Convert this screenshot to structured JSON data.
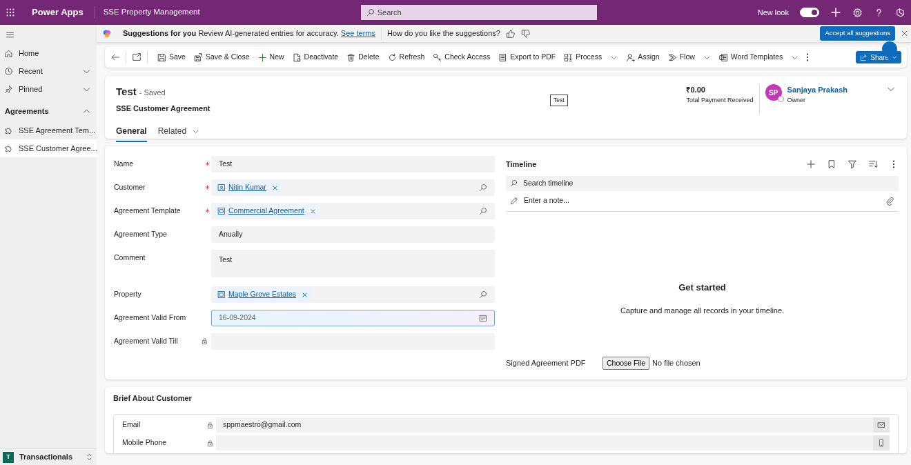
{
  "app_bar": {
    "app_name": "Power Apps",
    "environment": "SSE Property Management",
    "search_placeholder": "Search",
    "new_look": {
      "label": "New look",
      "on": true
    }
  },
  "sidebar": {
    "items": [
      {
        "label": "Home"
      },
      {
        "label": "Recent",
        "expanded": false
      },
      {
        "label": "Pinned",
        "expanded": false
      }
    ],
    "group": {
      "label": "Agreements",
      "expanded": true,
      "items": [
        {
          "label": "SSE Agreement Tem...",
          "selected": false
        },
        {
          "label": "SSE Customer Agree...",
          "selected": true
        }
      ]
    },
    "area": {
      "badge": "T",
      "label": "Transactionals"
    }
  },
  "suggestion_bar": {
    "title": "Suggestions for you",
    "message": "Review AI-generated entries for accuracy.",
    "link": "See terms",
    "feedback": "How do you like the suggestions?",
    "accept_button": "Accept all suggestions"
  },
  "command_bar": {
    "commands": [
      {
        "label": "Save",
        "dropdown": false
      },
      {
        "label": "Save & Close",
        "dropdown": false
      },
      {
        "label": "New",
        "dropdown": false
      },
      {
        "label": "Deactivate",
        "dropdown": false
      },
      {
        "label": "Delete",
        "dropdown": false
      },
      {
        "label": "Refresh",
        "dropdown": false
      },
      {
        "label": "Check Access",
        "dropdown": false
      },
      {
        "label": "Export to PDF",
        "dropdown": false
      },
      {
        "label": "Process",
        "dropdown": true
      },
      {
        "label": "Assign",
        "dropdown": false
      },
      {
        "label": "Flow",
        "dropdown": true
      },
      {
        "label": "Word Templates",
        "dropdown": true
      }
    ],
    "share": "Share"
  },
  "header": {
    "title": "Test",
    "status": "- Saved",
    "entity": "SSE Customer Agreement",
    "tooltip": "Test",
    "total": {
      "value": "₹0.00",
      "label": "Total Payment Received"
    },
    "owner": {
      "initials": "SP",
      "name": "Sanjaya Prakash",
      "role": "Owner"
    },
    "tabs": [
      {
        "label": "General",
        "selected": true,
        "dropdown": false
      },
      {
        "label": "Related",
        "selected": false,
        "dropdown": true
      }
    ]
  },
  "form": {
    "fields": [
      {
        "label": "Name",
        "required": true,
        "locked": false,
        "focused": false,
        "kind": "text",
        "value": "Test"
      },
      {
        "label": "Customer",
        "required": true,
        "locked": false,
        "focused": false,
        "kind": "lookup",
        "value": "Nitin Kumar"
      },
      {
        "label": "Agreement Template",
        "required": true,
        "locked": false,
        "focused": false,
        "kind": "lookup",
        "value": "Commercial Agreement"
      },
      {
        "label": "Agreement Type",
        "required": false,
        "locked": false,
        "focused": false,
        "kind": "text",
        "value": "Anually"
      },
      {
        "label": "Comment",
        "required": false,
        "locked": false,
        "focused": false,
        "kind": "textarea",
        "value": "Test"
      },
      {
        "label": "Property",
        "required": false,
        "locked": false,
        "focused": false,
        "kind": "lookup",
        "value": "Maple Grove Estates"
      },
      {
        "label": "Agreement Valid From",
        "required": false,
        "locked": false,
        "focused": true,
        "kind": "date",
        "value": "16-09-2024"
      },
      {
        "label": "Agreement Valid Till",
        "required": false,
        "locked": true,
        "focused": false,
        "kind": "text"
      }
    ]
  },
  "timeline": {
    "title": "Timeline",
    "search_placeholder": "Search timeline",
    "note_placeholder": "Enter a note...",
    "empty_title": "Get started",
    "empty_message": "Capture and manage all records in your timeline."
  },
  "signed_pdf": {
    "label": "Signed Agreement PDF",
    "button": "Choose File",
    "status": "No file chosen"
  },
  "brief": {
    "title": "Brief About Customer",
    "fields": [
      {
        "label": "Email",
        "locked": true,
        "kind": "email",
        "value": "sppmaestro@gmail.com"
      },
      {
        "label": "Mobile Phone",
        "locked": true,
        "kind": "phone"
      }
    ]
  }
}
